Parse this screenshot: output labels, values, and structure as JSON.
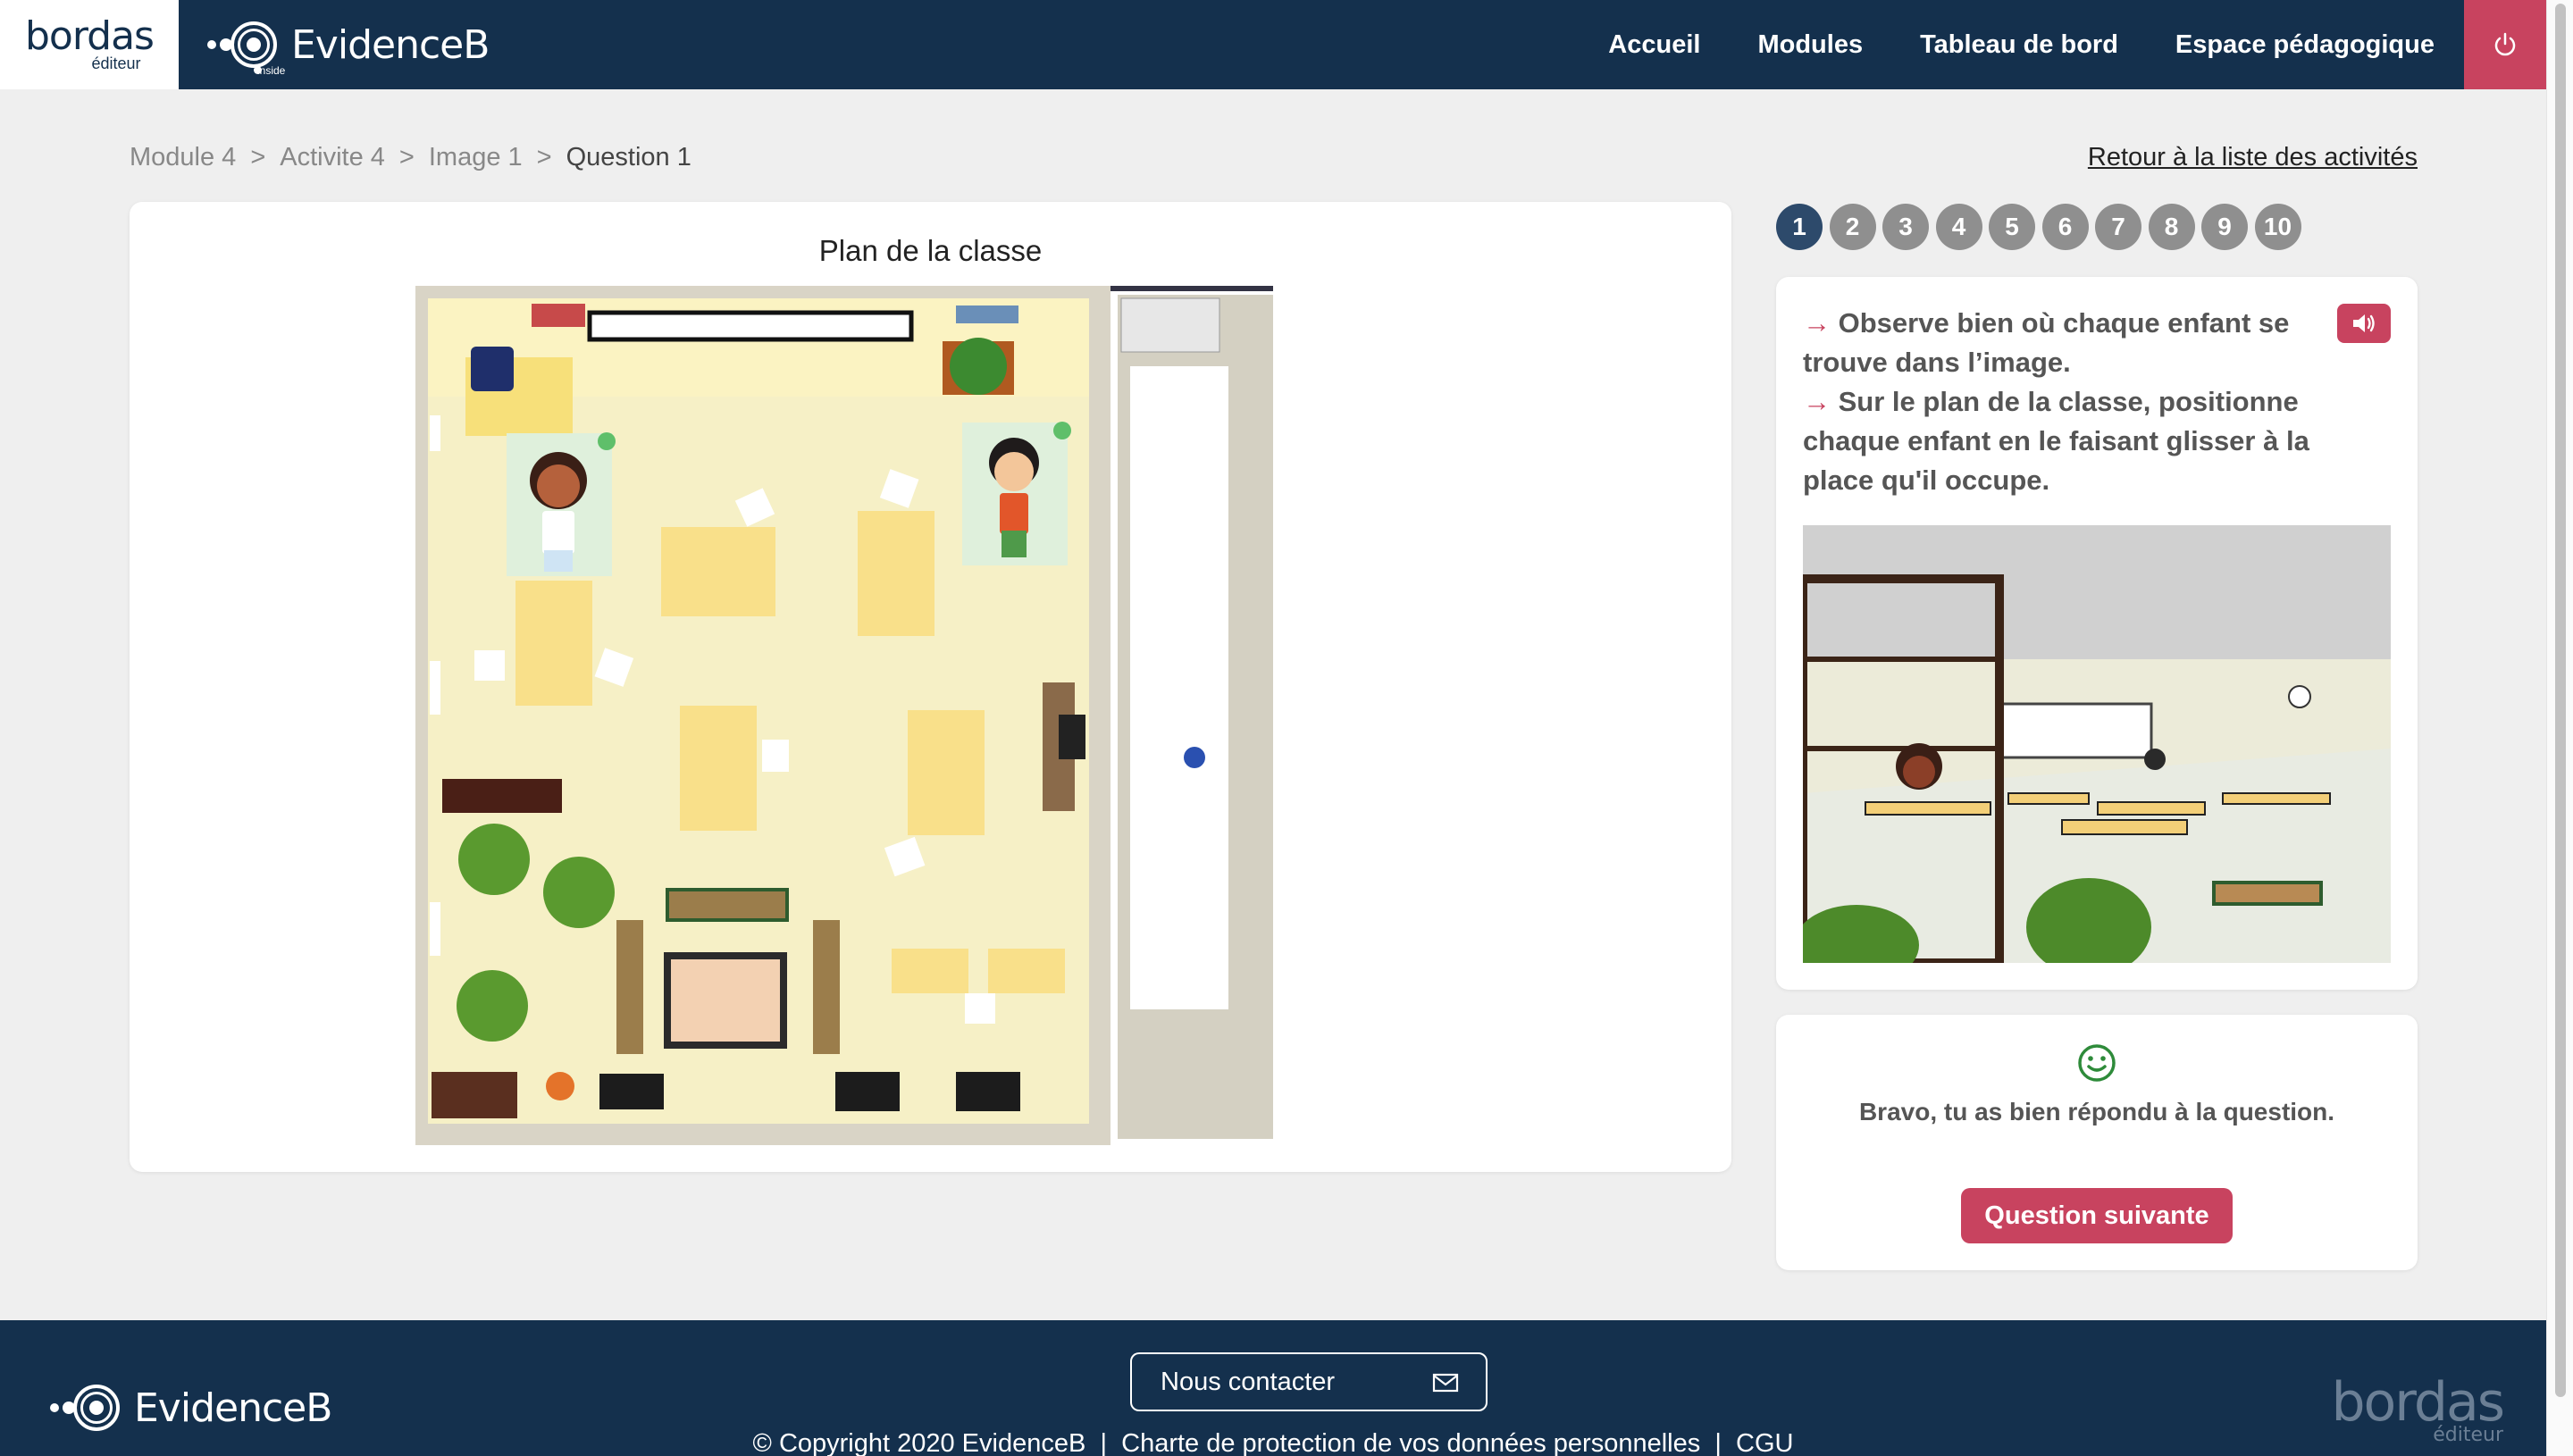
{
  "header": {
    "bordas_logo_text": "bordas",
    "bordas_logo_sub": "éditeur",
    "evidence_logo_text": "EvidenceB",
    "evidence_logo_sub": "inside",
    "nav": {
      "home": "Accueil",
      "modules": "Modules",
      "dashboard": "Tableau de bord",
      "teacher_space": "Espace pédagogique"
    },
    "power_icon": "power-icon"
  },
  "breadcrumb": {
    "module": "Module 4",
    "activity": "Activite 4",
    "image": "Image 1",
    "question": "Question 1",
    "separator": ">"
  },
  "back_link": "Retour à la liste des activités",
  "main": {
    "plan_title": "Plan de la classe"
  },
  "question_numbers": [
    "1",
    "2",
    "3",
    "4",
    "5",
    "6",
    "7",
    "8",
    "9",
    "10"
  ],
  "active_question": "1",
  "instructions": {
    "arrow": "→",
    "line1": "Observe bien où chaque enfant se trouve dans l’image.",
    "line2": "Sur le plan de la classe, positionne chaque enfant en le faisant glisser à la place qu'il occupe.",
    "sound_icon": "speaker-icon"
  },
  "feedback": {
    "icon": "smiley-icon",
    "text": "Bravo, tu as bien répondu à la question.",
    "next_button": "Question suivante"
  },
  "footer": {
    "contact": "Nous contacter",
    "mail_icon": "mail-icon",
    "copyright": "© Copyright 2020 EvidenceB",
    "privacy": "Charte de protection de vos données personnelles",
    "cgu": "CGU",
    "separator": "|",
    "bordas_text": "bordas",
    "bordas_sub": "éditeur",
    "evidence_text": "EvidenceB"
  },
  "colors": {
    "header_bg": "#14304d",
    "accent": "#c8435f",
    "active_number": "#2d4a6b",
    "inactive_number": "#8f8f8f",
    "success": "#2e8b3a"
  }
}
